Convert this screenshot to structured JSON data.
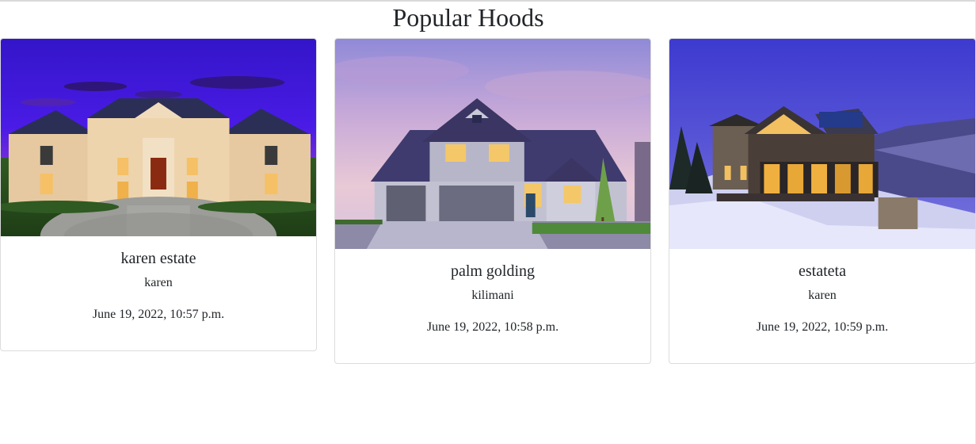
{
  "page": {
    "title": "Popular Hoods"
  },
  "cards": [
    {
      "name": "karen estate",
      "location": "karen",
      "created": "June 19, 2022, 10:57 p.m.",
      "image_icon": "mansion-photo"
    },
    {
      "name": "palm golding",
      "location": "kilimani",
      "created": "June 19, 2022, 10:58 p.m.",
      "image_icon": "suburban-house-photo"
    },
    {
      "name": "estateta",
      "location": "karen",
      "created": "June 19, 2022, 10:59 p.m.",
      "image_icon": "mountain-lodge-photo"
    }
  ],
  "colors": {
    "text": "#212529",
    "card_border": "#dcdcdc",
    "sky_violet": "#3a1fd8",
    "sky_dusk": "#9b8fe0",
    "sky_blue": "#4b4ccb"
  }
}
